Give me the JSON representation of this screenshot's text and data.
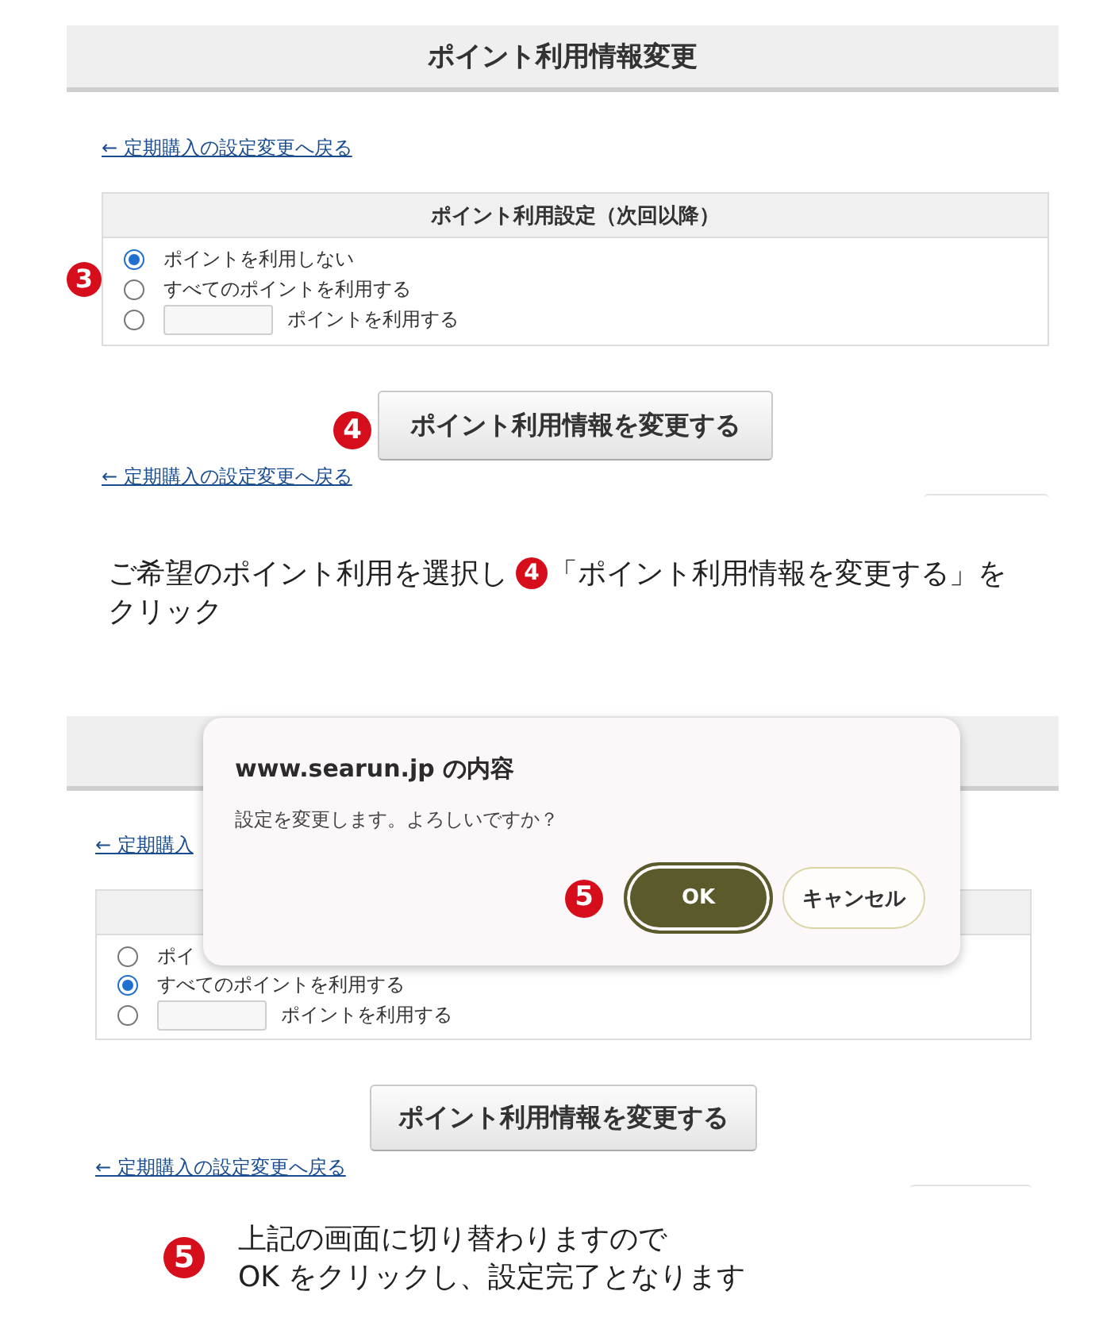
{
  "step_one": {
    "screen": {
      "title": "ポイント利用情報変更",
      "back_link": "← 定期購入の設定変更へ戻る",
      "settings": {
        "heading": "ポイント利用設定（次回以降）",
        "badge": "3",
        "options": [
          {
            "kind": "plain",
            "label": "ポイントを利用しない",
            "selected": true
          },
          {
            "kind": "plain",
            "label": "すべてのポイントを利用する",
            "selected": false
          },
          {
            "kind": "amount",
            "label": "ポイントを利用する",
            "selected": false
          }
        ]
      },
      "submit": {
        "badge": "4",
        "label": "ポイント利用情報を変更する"
      },
      "bottom_link": "← 定期購入の設定変更へ戻る"
    },
    "instruction": {
      "lines": [
        [
          {
            "kind": "text",
            "text": "ご希望のポイント利用を選択し"
          },
          {
            "kind": "badge",
            "text": "4"
          },
          {
            "kind": "text",
            "text": "「ポイント利用情報を変更する」を"
          }
        ],
        [
          {
            "kind": "text",
            "text": "クリック"
          }
        ]
      ]
    }
  },
  "step_two": {
    "screen": {
      "back_link": "← 定期購入",
      "settings": {
        "options": [
          {
            "kind": "plain",
            "label": "ポイ",
            "selected": false
          },
          {
            "kind": "plain",
            "label": "すべてのポイントを利用する",
            "selected": true
          },
          {
            "kind": "amount",
            "label": "ポイントを利用する",
            "selected": false
          }
        ]
      },
      "submit": {
        "label": "ポイント利用情報を変更する"
      },
      "bottom_link": "← 定期購入の設定変更へ戻る"
    },
    "dialog": {
      "title": "www.searun.jp の内容",
      "message": "設定を変更します。よろしいですか？",
      "badge": "5",
      "buttons": [
        {
          "kind": "primary",
          "label": "OK"
        },
        {
          "kind": "secondary",
          "label": "キャンセル"
        }
      ]
    },
    "instruction": {
      "badge": "5",
      "lines": [
        "上記の画面に切り替わりますので",
        "OK をクリックし、設定完了となります"
      ]
    }
  }
}
